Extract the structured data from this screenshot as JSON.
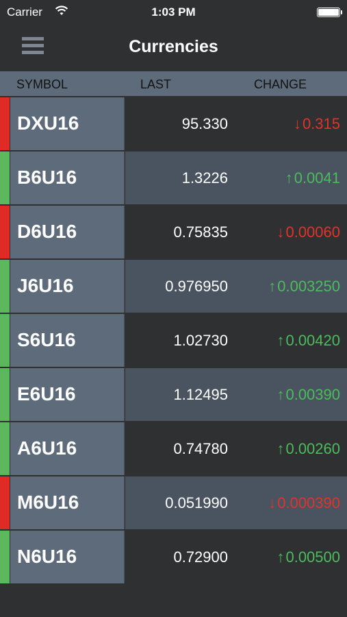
{
  "status_bar": {
    "carrier": "Carrier",
    "time": "1:03 PM"
  },
  "nav": {
    "title": "Currencies"
  },
  "table": {
    "headers": {
      "symbol": "SYMBOL",
      "last": "LAST",
      "change": "CHANGE"
    },
    "rows": [
      {
        "symbol": "DXU16",
        "last": "95.330",
        "change": "0.315",
        "direction": "down",
        "arrow": "↓"
      },
      {
        "symbol": "B6U16",
        "last": "1.3226",
        "change": "0.0041",
        "direction": "up",
        "arrow": "↑"
      },
      {
        "symbol": "D6U16",
        "last": "0.75835",
        "change": "0.00060",
        "direction": "down",
        "arrow": "↓"
      },
      {
        "symbol": "J6U16",
        "last": "0.976950",
        "change": "0.003250",
        "direction": "up",
        "arrow": "↑"
      },
      {
        "symbol": "S6U16",
        "last": "1.02730",
        "change": "0.00420",
        "direction": "up",
        "arrow": "↑"
      },
      {
        "symbol": "E6U16",
        "last": "1.12495",
        "change": "0.00390",
        "direction": "up",
        "arrow": "↑"
      },
      {
        "symbol": "A6U16",
        "last": "0.74780",
        "change": "0.00260",
        "direction": "up",
        "arrow": "↑"
      },
      {
        "symbol": "M6U16",
        "last": "0.051990",
        "change": "0.000390",
        "direction": "down",
        "arrow": "↓"
      },
      {
        "symbol": "N6U16",
        "last": "0.72900",
        "change": "0.00500",
        "direction": "up",
        "arrow": "↑"
      }
    ]
  },
  "colors": {
    "up": "#4cbc5c",
    "down": "#e0342b",
    "header_bg": "#5e6b7b",
    "app_bg": "#2f3032"
  }
}
